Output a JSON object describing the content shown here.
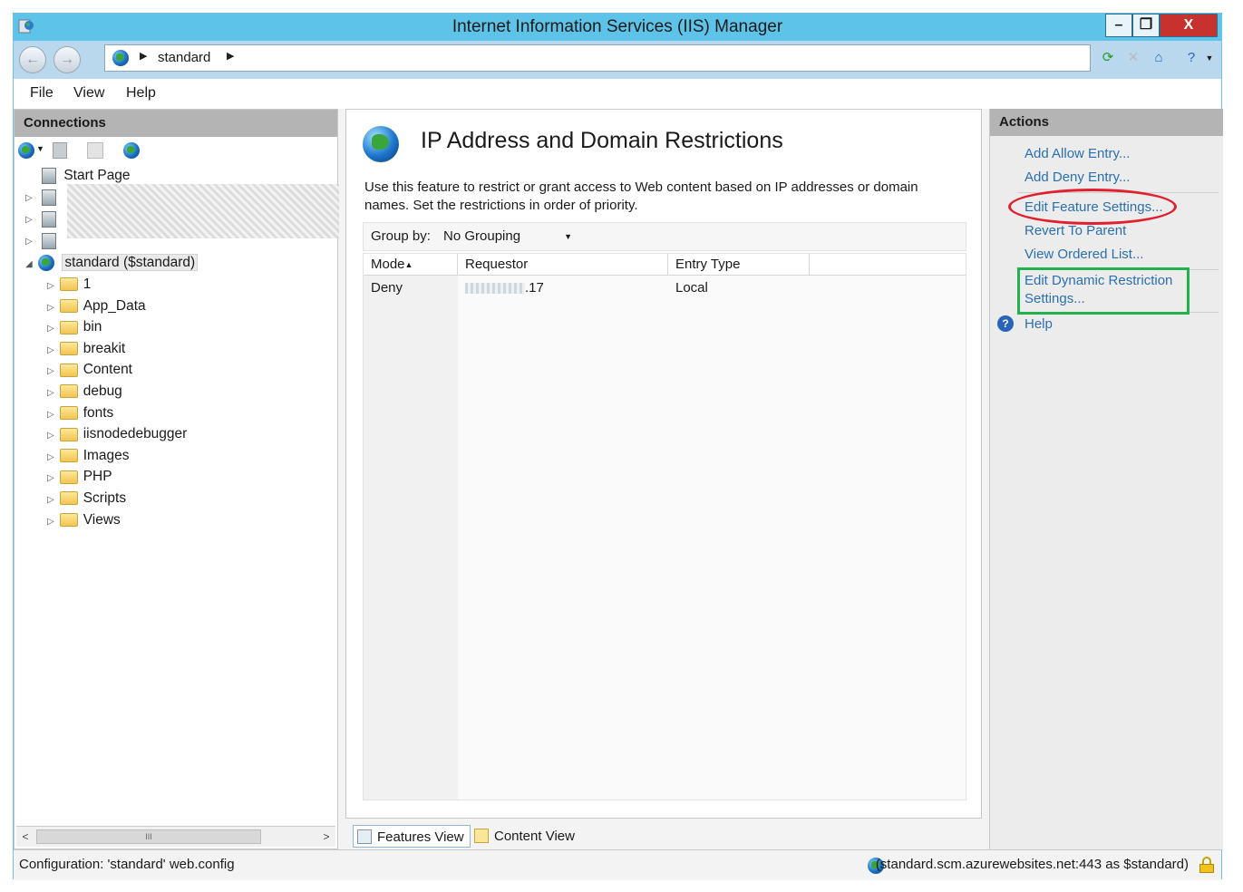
{
  "window": {
    "title": "Internet Information Services (IIS) Manager",
    "controls": {
      "minimize": "–",
      "maximize": "❐",
      "close": "X"
    }
  },
  "address": {
    "crumbs": [
      "standard"
    ]
  },
  "menu": {
    "items": [
      "File",
      "View",
      "Help"
    ]
  },
  "connections": {
    "header": "Connections",
    "start_page": "Start Page",
    "site": "standard ($standard)",
    "folders": [
      "1",
      "App_Data",
      "bin",
      "breakit",
      "Content",
      "debug",
      "fonts",
      "iisnodedebugger",
      "Images",
      "PHP",
      "Scripts",
      "Views"
    ],
    "scroll_thumb": "III"
  },
  "feature": {
    "title": "IP Address and Domain Restrictions",
    "description": "Use this feature to restrict or grant access to Web content based on IP addresses or domain names. Set the restrictions in order of priority.",
    "group_by_label": "Group by:",
    "group_by_value": "No Grouping",
    "columns": [
      "Mode",
      "Requestor",
      "Entry Type"
    ],
    "rows": [
      {
        "mode": "Deny",
        "requestor": ".17",
        "entry_type": "Local"
      }
    ]
  },
  "view_tabs": {
    "features": "Features View",
    "content": "Content View"
  },
  "actions": {
    "header": "Actions",
    "add_allow": "Add Allow Entry...",
    "add_deny": "Add Deny Entry...",
    "edit_feature": "Edit Feature Settings...",
    "revert": "Revert To Parent",
    "view_ordered": "View Ordered List...",
    "edit_dynamic": "Edit Dynamic Restriction Settings...",
    "help": "Help"
  },
  "status": {
    "left": "Configuration: 'standard' web.config",
    "right": "(standard.scm.azurewebsites.net:443 as $standard)"
  },
  "colors": {
    "titlebar": "#5ec3e8",
    "link": "#2a6fb0",
    "red_highlight": "#e0202e",
    "green_highlight": "#22b14c"
  }
}
